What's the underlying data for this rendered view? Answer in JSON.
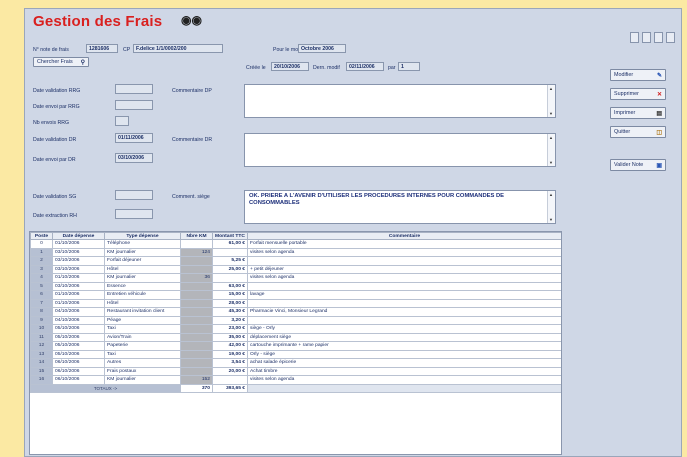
{
  "header": {
    "title": "Gestion des Frais",
    "search_icon": "binoculars-icon"
  },
  "fields": {
    "note_label": "N° note de frais",
    "note_value": "1281606",
    "cp_label": "CP",
    "employee": "F.delice 1/1/0002/200",
    "pour_mois_label": "Pour le mois",
    "pour_mois_value": "Octobre 2006",
    "chercher": "Chercher Frais",
    "creee_label": "Créée le",
    "creee_value": "20/10/2006",
    "dern_label": "Dern. modif",
    "dern_value": "02/11/2006",
    "par_label": "par",
    "par_value": "1",
    "date_validation_rrg": "Date validation RRG",
    "date_envoi_rrg": "Date envoi par RRG",
    "nb_envois_rrg": "Nb envois RRG",
    "date_validation_dr": "Date validation DR",
    "date_validation_dr_value": "01/11/2006",
    "date_envoi_dr": "Date envoi par DR",
    "date_envoi_dr_value": "03/10/2006",
    "date_validation_sg": "Date validation SG",
    "date_extraction_rh": "Date extraction RH",
    "commentaire_dp": "Commentaire DP",
    "commentaire_dr": "Commentaire DR",
    "comment_siege": "Comment. siège",
    "comment_siege_text": "OK. PRIERE A L'AVENIR D'UTILISER LES PROCEDURES INTERNES POUR COMMANDES DE CONSOMMABLES"
  },
  "side_buttons": [
    {
      "label": "Modifier",
      "icon": "edit-icon",
      "color": "#2a56b5"
    },
    {
      "label": "Supprimer",
      "icon": "delete-x-icon",
      "color": "#d21f1f"
    },
    {
      "label": "Imprimer",
      "icon": "printer-icon",
      "color": "#333333"
    },
    {
      "label": "Quitter",
      "icon": "exit-door-icon",
      "color": "#b07a1e"
    },
    {
      "label": "Valider Note",
      "icon": "validate-icon",
      "color": "#2a56b5"
    }
  ],
  "table": {
    "headers": [
      "Poste",
      "Date dépense",
      "Type dépense",
      "Nbre KM",
      "Montant TTC",
      "Commentaire"
    ],
    "rows": [
      [
        "0",
        "01/10/2006",
        "Téléphone",
        "",
        "61,00 €",
        "Forfait mensuelle portable"
      ],
      [
        "1",
        "03/10/2006",
        "KM journalier",
        "124",
        "",
        "visites selon agenda"
      ],
      [
        "2",
        "03/10/2006",
        "Forfait déjeuner",
        "",
        "5,25 €",
        ""
      ],
      [
        "3",
        "03/10/2006",
        "Hôtel",
        "",
        "25,00 €",
        "+ petit déjeuner"
      ],
      [
        "4",
        "01/10/2006",
        "KM journalier",
        "36",
        "",
        "visites selon agenda"
      ],
      [
        "5",
        "03/10/2006",
        "Essence",
        "",
        "63,00 €",
        ""
      ],
      [
        "6",
        "01/10/2006",
        "Entretien véhicule",
        "",
        "15,00 €",
        "lavage"
      ],
      [
        "7",
        "01/10/2006",
        "Hôtel",
        "",
        "28,00 €",
        ""
      ],
      [
        "8",
        "04/10/2006",
        "Restaurant invitation client",
        "",
        "45,30 €",
        "Pharmacie Vinci, Monsieur Legrand"
      ],
      [
        "9",
        "04/10/2006",
        "Péage",
        "",
        "3,20 €",
        ""
      ],
      [
        "10",
        "05/10/2006",
        "Taxi",
        "",
        "23,00 €",
        "siège - Orly"
      ],
      [
        "11",
        "05/10/2006",
        "Avion/Train",
        "",
        "35,00 €",
        "déplacement siège"
      ],
      [
        "12",
        "05/10/2006",
        "Papeterie",
        "",
        "42,00 €",
        "cartouche imprimante + rame papier"
      ],
      [
        "13",
        "05/10/2006",
        "Taxi",
        "",
        "19,00 €",
        "Orly - siège"
      ],
      [
        "14",
        "06/10/2006",
        "Autres",
        "",
        "3,54 €",
        "achat salade épicerie"
      ],
      [
        "15",
        "06/10/2006",
        "Frais postaux",
        "",
        "20,00 €",
        "Achat timbre"
      ],
      [
        "16",
        "06/10/2006",
        "KM journalier",
        "152",
        "",
        "visites selon agenda"
      ]
    ],
    "total_km": "370",
    "total_amount": "393,65 €",
    "footer": "TOTAUX ->"
  }
}
